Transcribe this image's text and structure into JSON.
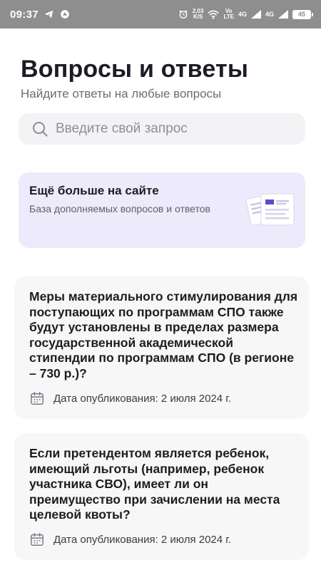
{
  "status_bar": {
    "time": "09:37",
    "net_speed_top": "2,03",
    "net_speed_bottom": "K/S",
    "volte_top": "Vo",
    "volte_bottom": "LTE",
    "sig1": "4G",
    "sig2": "4G",
    "battery": "45",
    "icons": [
      "telegram-icon",
      "vpn-icon",
      "alarm-icon",
      "wifi-icon",
      "signal-icon",
      "battery-icon"
    ]
  },
  "header": {
    "title": "Вопросы и ответы",
    "subtitle": "Найдите ответы на любые вопросы"
  },
  "search": {
    "placeholder": "Введите свой запрос",
    "value": ""
  },
  "promo": {
    "title": "Ещё больше на сайте",
    "description": "База дополняемых вопросов и ответов",
    "accent_color": "#5b4bc9"
  },
  "questions": [
    {
      "text": "Меры материального стимулирования для поступающих по программам СПО также будут установлены в пределах размера государственной академической стипендии по программам СПО (в регионе – 730 р.)?",
      "date": "Дата опубликования: 2 июля 2024 г."
    },
    {
      "text": "Если претендентом является ребенок, имеющий льготы (например, ребенок участника СВО), имеет ли он преимущество при зачислении на места целевой квоты?",
      "date": "Дата опубликования: 2 июля 2024 г."
    }
  ]
}
